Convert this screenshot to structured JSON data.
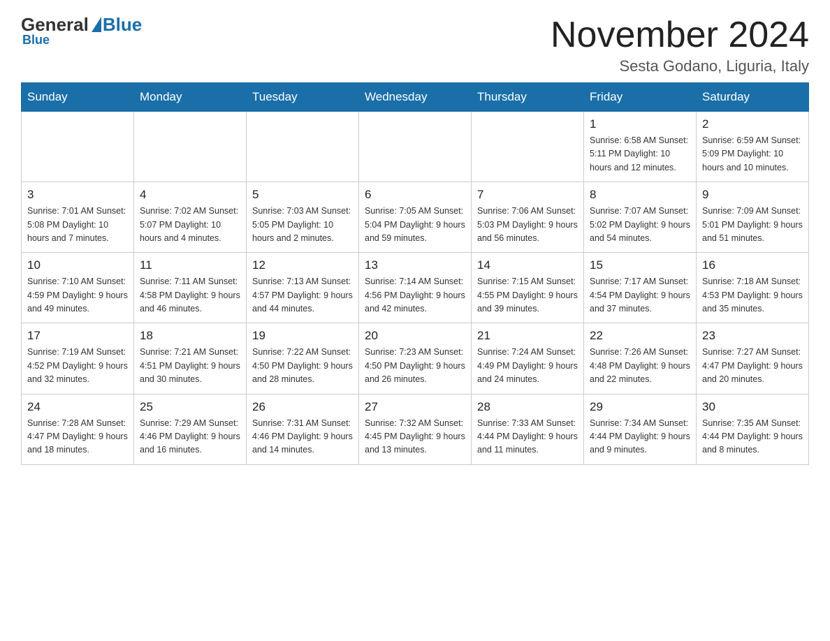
{
  "header": {
    "logo_general": "General",
    "logo_blue": "Blue",
    "title": "November 2024",
    "subtitle": "Sesta Godano, Liguria, Italy"
  },
  "days_of_week": [
    "Sunday",
    "Monday",
    "Tuesday",
    "Wednesday",
    "Thursday",
    "Friday",
    "Saturday"
  ],
  "weeks": [
    [
      {
        "day": "",
        "info": ""
      },
      {
        "day": "",
        "info": ""
      },
      {
        "day": "",
        "info": ""
      },
      {
        "day": "",
        "info": ""
      },
      {
        "day": "",
        "info": ""
      },
      {
        "day": "1",
        "info": "Sunrise: 6:58 AM\nSunset: 5:11 PM\nDaylight: 10 hours\nand 12 minutes."
      },
      {
        "day": "2",
        "info": "Sunrise: 6:59 AM\nSunset: 5:09 PM\nDaylight: 10 hours\nand 10 minutes."
      }
    ],
    [
      {
        "day": "3",
        "info": "Sunrise: 7:01 AM\nSunset: 5:08 PM\nDaylight: 10 hours\nand 7 minutes."
      },
      {
        "day": "4",
        "info": "Sunrise: 7:02 AM\nSunset: 5:07 PM\nDaylight: 10 hours\nand 4 minutes."
      },
      {
        "day": "5",
        "info": "Sunrise: 7:03 AM\nSunset: 5:05 PM\nDaylight: 10 hours\nand 2 minutes."
      },
      {
        "day": "6",
        "info": "Sunrise: 7:05 AM\nSunset: 5:04 PM\nDaylight: 9 hours\nand 59 minutes."
      },
      {
        "day": "7",
        "info": "Sunrise: 7:06 AM\nSunset: 5:03 PM\nDaylight: 9 hours\nand 56 minutes."
      },
      {
        "day": "8",
        "info": "Sunrise: 7:07 AM\nSunset: 5:02 PM\nDaylight: 9 hours\nand 54 minutes."
      },
      {
        "day": "9",
        "info": "Sunrise: 7:09 AM\nSunset: 5:01 PM\nDaylight: 9 hours\nand 51 minutes."
      }
    ],
    [
      {
        "day": "10",
        "info": "Sunrise: 7:10 AM\nSunset: 4:59 PM\nDaylight: 9 hours\nand 49 minutes."
      },
      {
        "day": "11",
        "info": "Sunrise: 7:11 AM\nSunset: 4:58 PM\nDaylight: 9 hours\nand 46 minutes."
      },
      {
        "day": "12",
        "info": "Sunrise: 7:13 AM\nSunset: 4:57 PM\nDaylight: 9 hours\nand 44 minutes."
      },
      {
        "day": "13",
        "info": "Sunrise: 7:14 AM\nSunset: 4:56 PM\nDaylight: 9 hours\nand 42 minutes."
      },
      {
        "day": "14",
        "info": "Sunrise: 7:15 AM\nSunset: 4:55 PM\nDaylight: 9 hours\nand 39 minutes."
      },
      {
        "day": "15",
        "info": "Sunrise: 7:17 AM\nSunset: 4:54 PM\nDaylight: 9 hours\nand 37 minutes."
      },
      {
        "day": "16",
        "info": "Sunrise: 7:18 AM\nSunset: 4:53 PM\nDaylight: 9 hours\nand 35 minutes."
      }
    ],
    [
      {
        "day": "17",
        "info": "Sunrise: 7:19 AM\nSunset: 4:52 PM\nDaylight: 9 hours\nand 32 minutes."
      },
      {
        "day": "18",
        "info": "Sunrise: 7:21 AM\nSunset: 4:51 PM\nDaylight: 9 hours\nand 30 minutes."
      },
      {
        "day": "19",
        "info": "Sunrise: 7:22 AM\nSunset: 4:50 PM\nDaylight: 9 hours\nand 28 minutes."
      },
      {
        "day": "20",
        "info": "Sunrise: 7:23 AM\nSunset: 4:50 PM\nDaylight: 9 hours\nand 26 minutes."
      },
      {
        "day": "21",
        "info": "Sunrise: 7:24 AM\nSunset: 4:49 PM\nDaylight: 9 hours\nand 24 minutes."
      },
      {
        "day": "22",
        "info": "Sunrise: 7:26 AM\nSunset: 4:48 PM\nDaylight: 9 hours\nand 22 minutes."
      },
      {
        "day": "23",
        "info": "Sunrise: 7:27 AM\nSunset: 4:47 PM\nDaylight: 9 hours\nand 20 minutes."
      }
    ],
    [
      {
        "day": "24",
        "info": "Sunrise: 7:28 AM\nSunset: 4:47 PM\nDaylight: 9 hours\nand 18 minutes."
      },
      {
        "day": "25",
        "info": "Sunrise: 7:29 AM\nSunset: 4:46 PM\nDaylight: 9 hours\nand 16 minutes."
      },
      {
        "day": "26",
        "info": "Sunrise: 7:31 AM\nSunset: 4:46 PM\nDaylight: 9 hours\nand 14 minutes."
      },
      {
        "day": "27",
        "info": "Sunrise: 7:32 AM\nSunset: 4:45 PM\nDaylight: 9 hours\nand 13 minutes."
      },
      {
        "day": "28",
        "info": "Sunrise: 7:33 AM\nSunset: 4:44 PM\nDaylight: 9 hours\nand 11 minutes."
      },
      {
        "day": "29",
        "info": "Sunrise: 7:34 AM\nSunset: 4:44 PM\nDaylight: 9 hours\nand 9 minutes."
      },
      {
        "day": "30",
        "info": "Sunrise: 7:35 AM\nSunset: 4:44 PM\nDaylight: 9 hours\nand 8 minutes."
      }
    ]
  ]
}
